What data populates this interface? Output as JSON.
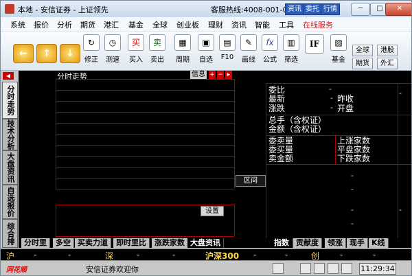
{
  "window": {
    "title": "本地 - 安信证券 - 上证领先",
    "hotline": "客服热线:4008-001-001",
    "title_buttons": [
      "资讯",
      "委托",
      "行情"
    ]
  },
  "menu": {
    "items": [
      "系统",
      "报价",
      "分析",
      "期货",
      "港汇",
      "基金",
      "全球",
      "创业板",
      "理财",
      "资讯",
      "智能",
      "工具"
    ],
    "highlight": "在线服务",
    "highlight_color": "#d42020"
  },
  "toolbar": {
    "tools": [
      {
        "icon": "restore-icon",
        "label": "修正"
      },
      {
        "icon": "speed-test-icon",
        "label": "测速"
      },
      {
        "icon": "buy-icon",
        "label": "买入",
        "glyph": "买"
      },
      {
        "icon": "sell-icon",
        "label": "卖出",
        "glyph": "卖"
      },
      {
        "icon": "period-icon",
        "label": "周期"
      },
      {
        "icon": "watchlist-icon",
        "label": "自选"
      },
      {
        "icon": "f10-icon",
        "label": "F10"
      },
      {
        "icon": "draw-line-icon",
        "label": "画线"
      },
      {
        "icon": "formula-icon",
        "label": "公式",
        "glyph": "fx"
      },
      {
        "icon": "filter-icon",
        "label": "筛选"
      },
      {
        "icon": "fund-icon",
        "label": "基金"
      }
    ],
    "side_buttons": [
      "全球",
      "港股",
      "期货",
      "外汇"
    ]
  },
  "left_tabs": [
    "分时走势",
    "技术分析",
    "大盘资讯",
    "自选报价",
    "综合排名"
  ],
  "chart": {
    "title": "分时走势",
    "info_label": "信息",
    "area_button": "区间",
    "setting_button": "设置"
  },
  "quote_panel": {
    "row1": "委比",
    "row2a": "最新",
    "row2b": "昨收",
    "row3a": "涨跌",
    "row3b": "开盘",
    "row4": "总手（含权证）",
    "row5": "金额（含权证）",
    "row6a": "委卖量",
    "row6b": "上涨家数",
    "row7a": "委买量",
    "row7b": "平盘家数",
    "row8a": "卖金额",
    "row8b": "下跌家数",
    "dash": "-"
  },
  "bottom_tabs": {
    "left": [
      "分时里",
      "多空",
      "买卖力道",
      "即时里比",
      "涨跌家数",
      "大盘资讯"
    ],
    "left_active": 5,
    "right": [
      "指数",
      "贡献度",
      "领涨",
      "现手",
      "K线"
    ],
    "right_active": 0
  },
  "index_bar": {
    "sh": "沪",
    "sz": "深",
    "hs300": "沪深300",
    "cy": "创",
    "dash": "-"
  },
  "status": {
    "logo": "同花顺",
    "welcome": "安信证券欢迎你",
    "time": "11:29:34"
  }
}
